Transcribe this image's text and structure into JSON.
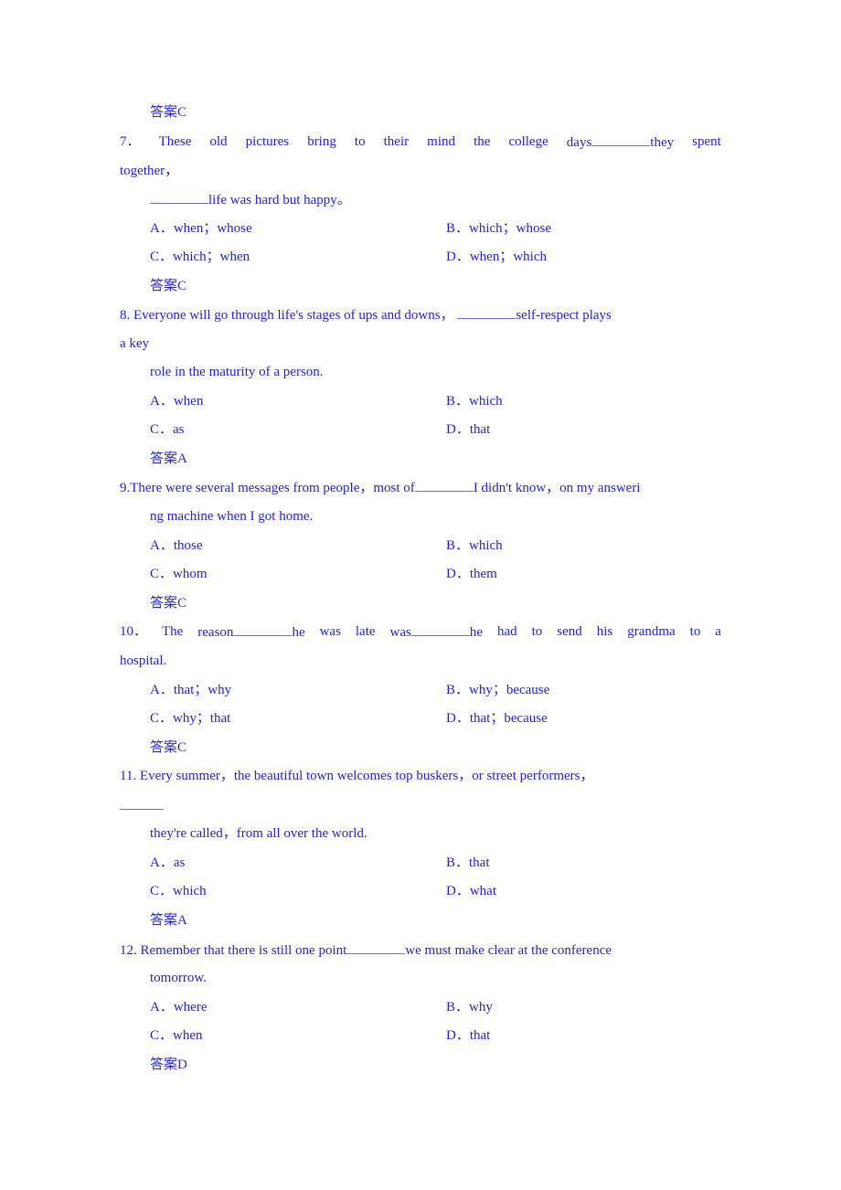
{
  "prev_answer": "答案C",
  "questions": [
    {
      "number": "7．",
      "stem_line1_pre": "These old pictures bring to their mind the college days",
      "stem_line1_post": "they spent",
      "stem_line2": "together，",
      "stem_line3_post": "life was hard but happy。",
      "options": {
        "A": "A．when；whose",
        "B": "B．which；whose",
        "C": "C．which；when",
        "D": "D．when；which"
      },
      "answer": "答案C"
    },
    {
      "number": "8.",
      "stem_line1_pre": "Everyone will go through life's stages of ups and downs，",
      "stem_line1_post": "self-respect plays",
      "stem_line2": "a key",
      "stem_line3": "role in the maturity of a person.",
      "options": {
        "A": "A．when",
        "B": "B．which",
        "C": "C．as",
        "D": "D．that"
      },
      "answer": "答案A"
    },
    {
      "number": "9.",
      "stem_line1_pre": "There were several messages from people，most of",
      "stem_line1_post": "I didn't know，on my answeri",
      "stem_line2": "ng machine when I got home.",
      "options": {
        "A": "A．those",
        "B": "B．which",
        "C": "C．whom",
        "D": "D．them"
      },
      "answer": "答案C"
    },
    {
      "number": "10．",
      "stem_line1_a": "The reason",
      "stem_line1_b": "he was late was",
      "stem_line1_c": "he had to send his grandma to a",
      "stem_line2": "hospital.",
      "options": {
        "A": "A．that；why",
        "B": "B．why；because",
        "C": "C．why；that",
        "D": "D．that；because"
      },
      "answer": "答案C"
    },
    {
      "number": "11.",
      "stem_line1": "Every summer，the beautiful town welcomes top buskers，or street performers，",
      "stem_line3": "they're called，from all over the world.",
      "options": {
        "A": "A．as",
        "B": "B．that",
        "C": "C．which",
        "D": "D．what"
      },
      "answer": "答案A"
    },
    {
      "number": "12.",
      "stem_line1_pre": "Remember that there is still one point",
      "stem_line1_post": "we must make clear at the conference",
      "stem_line2": "tomorrow.",
      "options": {
        "A": "A．where",
        "B": "B．why",
        "C": "C．when",
        "D": "D．that"
      },
      "answer": "答案D"
    }
  ]
}
